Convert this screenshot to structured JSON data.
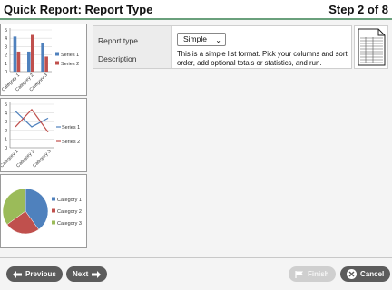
{
  "header": {
    "title": "Quick Report: Report Type",
    "step": "Step 2 of 8"
  },
  "form": {
    "report_type_label": "Report type",
    "report_type_value": "Simple",
    "description_label": "Description",
    "description_text": "This is a simple list format. Pick your columns and sort order, add optional totals or statistics, and run."
  },
  "thumbnails": {
    "bar": {
      "type": "bar",
      "categories": [
        "Category 1",
        "Category 2",
        "Category 3"
      ],
      "series": [
        {
          "name": "Series 1",
          "values": [
            4.2,
            2.4,
            3.4
          ]
        },
        {
          "name": "Series 2",
          "values": [
            2.4,
            4.4,
            1.8
          ]
        }
      ],
      "ylim": [
        0,
        5
      ],
      "y_ticks": [
        "0",
        "1",
        "2",
        "3",
        "4",
        "5"
      ]
    },
    "line": {
      "type": "line",
      "categories": [
        "Category 1",
        "Category 2",
        "Category 3"
      ],
      "series": [
        {
          "name": "Series 1",
          "values": [
            4.2,
            2.4,
            3.4
          ]
        },
        {
          "name": "Series 2",
          "values": [
            2.4,
            4.4,
            1.8
          ]
        }
      ],
      "ylim": [
        0,
        5
      ],
      "y_ticks": [
        "0",
        "1",
        "2",
        "3",
        "4",
        "5"
      ]
    },
    "pie": {
      "type": "pie",
      "categories": [
        "Category 1",
        "Category 2",
        "Category 3"
      ],
      "values": [
        40,
        25,
        35
      ]
    },
    "colors": {
      "series1": "#4f81bd",
      "series2": "#c0504d",
      "series3": "#9bbb59"
    }
  },
  "footer": {
    "previous": "Previous",
    "next": "Next",
    "finish": "Finish",
    "cancel": "Cancel"
  },
  "colors": {
    "accent": "#6aa07c",
    "button": "#5c5c5c",
    "button_disabled": "#cfcfcf"
  }
}
